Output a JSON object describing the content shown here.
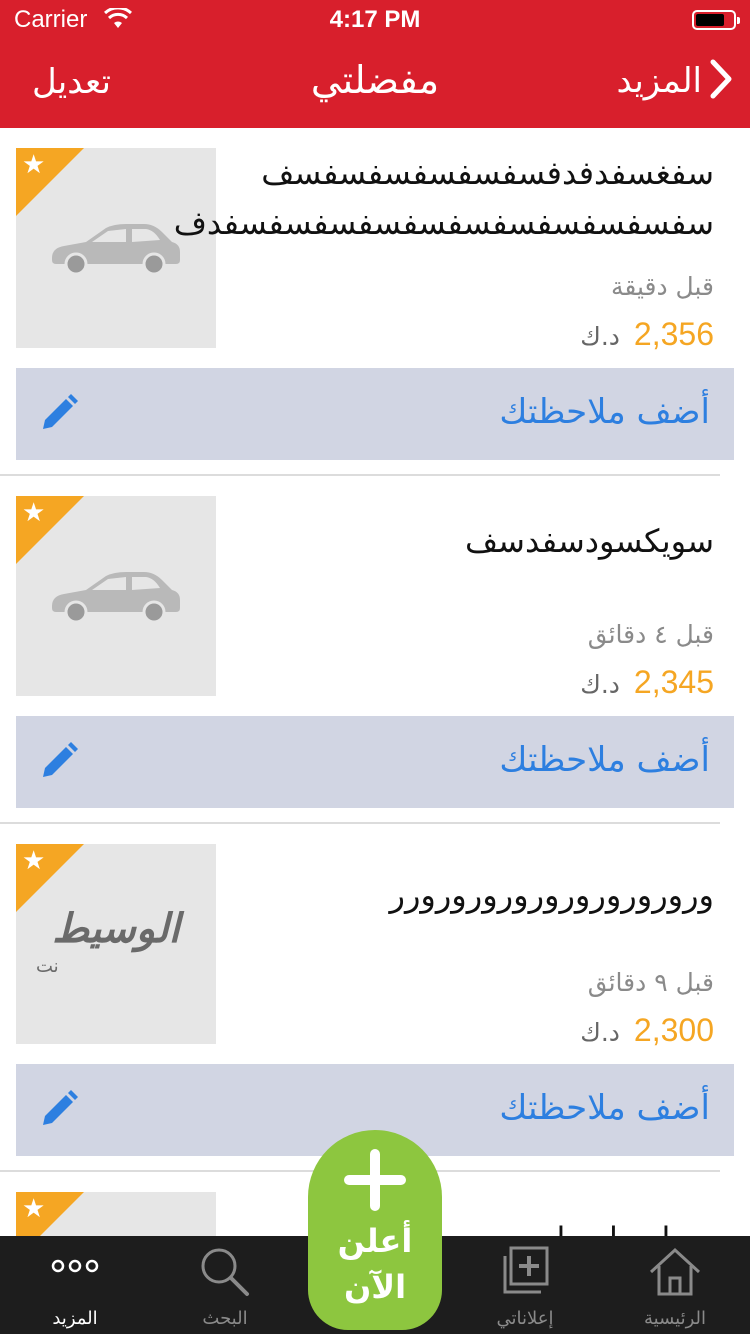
{
  "status_bar": {
    "carrier": "Carrier",
    "time": "4:17 PM"
  },
  "nav": {
    "title": "مفضلتي",
    "edit": "تعديل",
    "back": "المزيد"
  },
  "colors": {
    "nav_bg": "#d81f2c",
    "price": "#f5a623",
    "note_bg": "#d1d5e3",
    "note_text": "#2d7fe0",
    "fab": "#8dc63f",
    "tabbar": "#1d1d1d"
  },
  "listings": [
    {
      "title": "سفغسفدفدفسفسفسفسفسفسف سفسفسفسفسفسفسفسفسفسفسفدف",
      "time": "قبل دقيقة",
      "price": "2,356",
      "currency": "د.ك",
      "image": "car-placeholder-icon",
      "favorite": true,
      "note_label": "أضف ملاحظتك"
    },
    {
      "title": "سويكسودسفدسف",
      "time": "قبل ٤ دقائق",
      "price": "2,345",
      "currency": "د.ك",
      "image": "car-placeholder-icon",
      "favorite": true,
      "note_label": "أضف ملاحظتك"
    },
    {
      "title": "ورورورورورورورورورورر",
      "time": "قبل ٩ دقائق",
      "price": "2,300",
      "currency": "د.ك",
      "image": "alwaseet-logo",
      "logo_text": "الوسيط",
      "logo_sub": "نت",
      "favorite": true,
      "note_label": "أضف ملاحظتك"
    },
    {
      "title": "سداسداسداسد",
      "favorite": true
    }
  ],
  "fab": {
    "label": "أعلن الآن",
    "icon": "plus-icon"
  },
  "tabs": [
    {
      "label": "المزيد",
      "icon": "more-dots-icon",
      "active": true
    },
    {
      "label": "البحث",
      "icon": "search-icon",
      "active": false
    },
    {
      "label": "إعلاناتي",
      "icon": "my-ads-icon",
      "active": false
    },
    {
      "label": "الرئيسية",
      "icon": "home-icon",
      "active": false
    }
  ]
}
